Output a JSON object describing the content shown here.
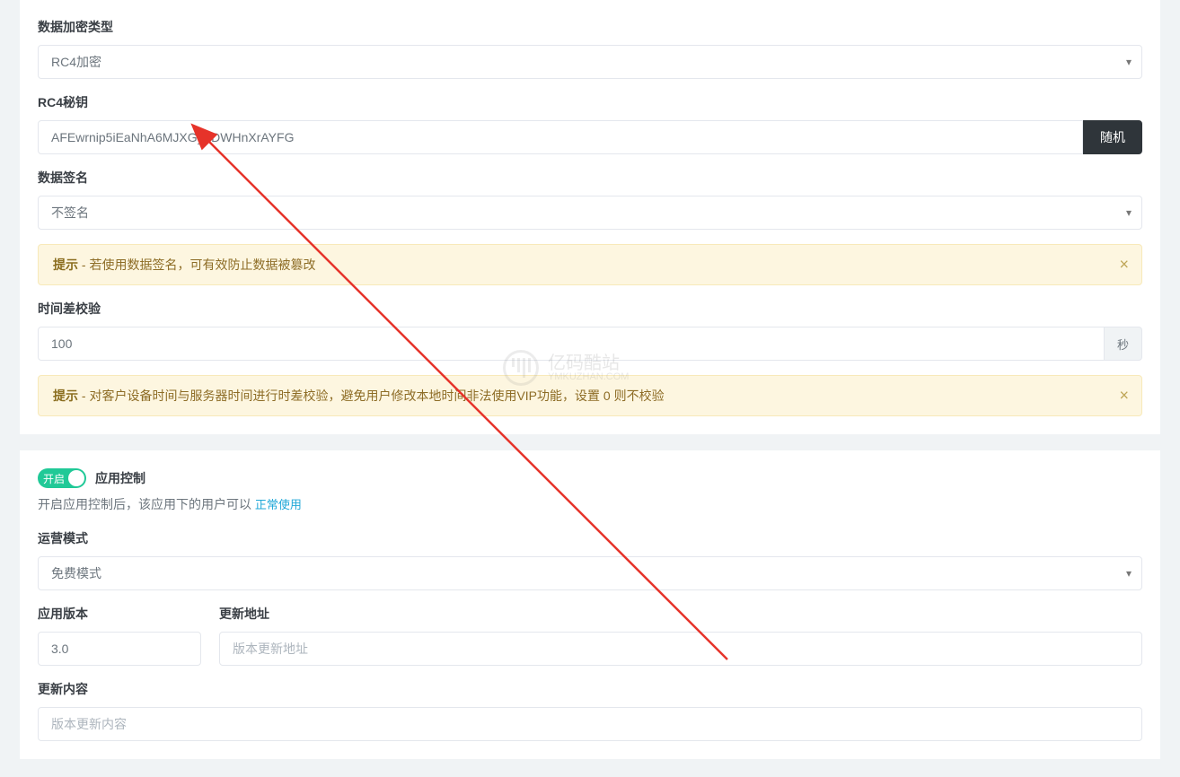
{
  "encrypt": {
    "label": "数据加密类型",
    "value": "RC4加密"
  },
  "rc4": {
    "label": "RC4秘钥",
    "value": "AFEwrnip5iEaNhA6MJXGyTDWHnXrAYFG",
    "btn": "随机"
  },
  "sign": {
    "label": "数据签名",
    "value": "不签名"
  },
  "alerts": {
    "prefix": "提示",
    "sign": " - 若使用数据签名，可有效防止数据被篡改",
    "time": " - 对客户设备时间与服务器时间进行时差校验，避免用户修改本地时间非法使用VIP功能，设置 0 则不校验"
  },
  "time": {
    "label": "时间差校验",
    "value": "100",
    "unit": "秒"
  },
  "appctrl": {
    "toggle": "开启",
    "title": "应用控制",
    "desc": "开启应用控制后，该应用下的用户可以 ",
    "link": "正常使用"
  },
  "mode": {
    "label": "运营模式",
    "value": "免费模式"
  },
  "version": {
    "label": "应用版本",
    "value": "3.0"
  },
  "updateUrl": {
    "label": "更新地址",
    "placeholder": "版本更新地址"
  },
  "updateContent": {
    "label": "更新内容",
    "placeholder": "版本更新内容"
  },
  "watermark": {
    "title": "亿码酷站",
    "sub": "YMKUZHAN.COM"
  }
}
